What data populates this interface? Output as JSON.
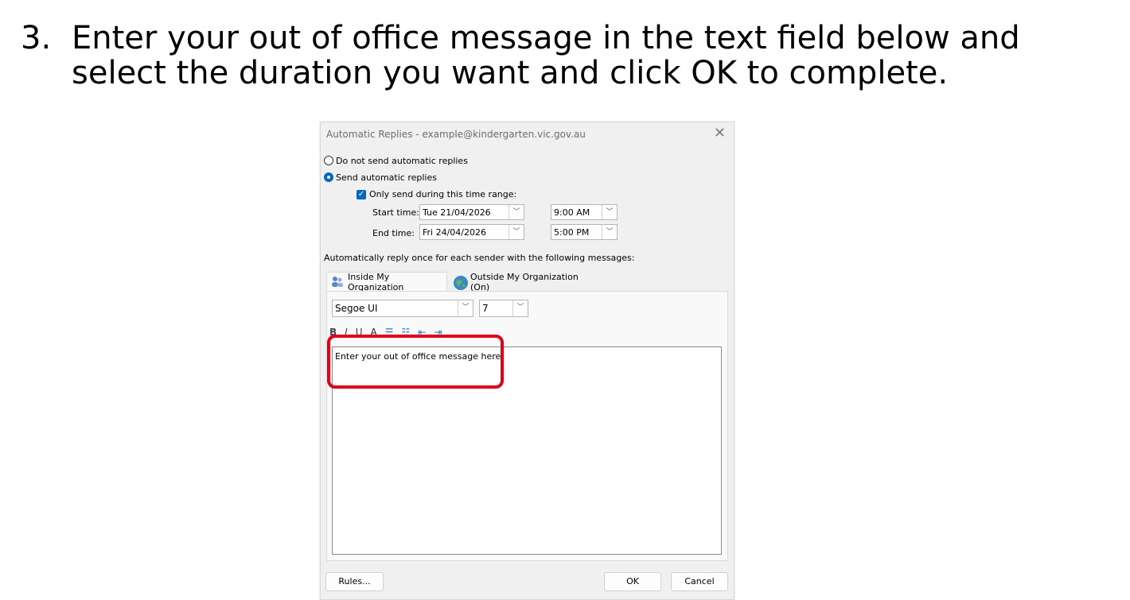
{
  "instruction": {
    "number": "3.",
    "text": "Enter your out of office message in the text field below and select the duration you want and click OK to complete."
  },
  "dialog": {
    "title": "Automatic Replies - example@kindergarten.vic.gov.au",
    "close_glyph": "✕",
    "radio_no_send": "Do not send automatic replies",
    "radio_send": "Send automatic replies",
    "selected_option": "Send automatic replies",
    "only_range_label": "Only send during this time range:",
    "only_range_checked": true,
    "start_label": "Start time:",
    "start_date": "Tue 21/04/2026",
    "start_time": "9:00 AM",
    "end_label": "End time:",
    "end_date": "Fri 24/04/2026",
    "end_time": "5:00 PM",
    "reply_info": "Automatically reply once for each sender with the following messages:",
    "tabs": [
      {
        "label": "Inside My Organization",
        "icon": "people-icon",
        "active": true
      },
      {
        "label": "Outside My Organization (On)",
        "icon": "globe-icon",
        "active": false
      }
    ],
    "font_name": "Segoe UI",
    "font_size": "7",
    "format_buttons": [
      "B",
      "I",
      "U",
      "A",
      "☰",
      "☷",
      "⇤",
      "⇥"
    ],
    "message_text": "Enter your out of office message here.",
    "rules_label": "Rules...",
    "ok_label": "OK",
    "cancel_label": "Cancel"
  },
  "colors": {
    "accent": "#0067c0",
    "highlight_border": "#e0001b",
    "dialog_bg": "#f0f0f0"
  }
}
